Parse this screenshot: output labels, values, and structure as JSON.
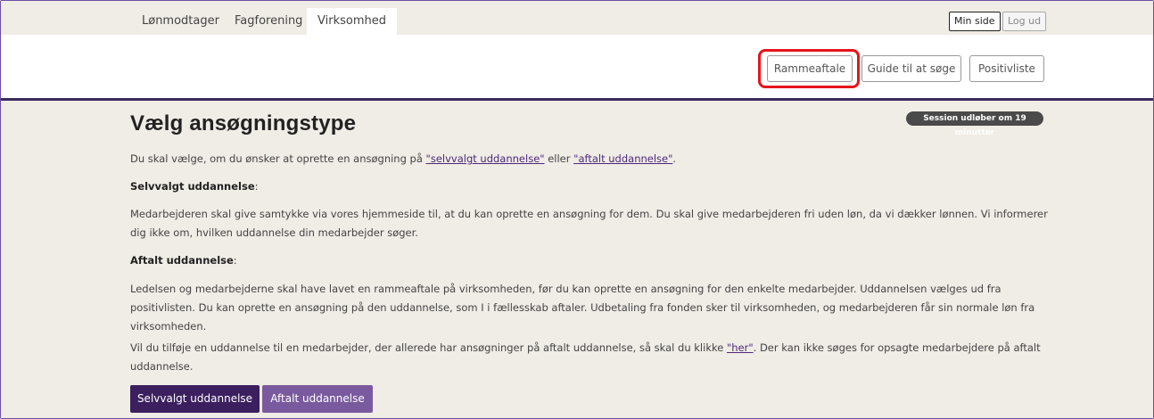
{
  "nav": {
    "tabs": [
      {
        "label": "Lønmodtager"
      },
      {
        "label": "Fagforening"
      },
      {
        "label": "Virksomhed"
      }
    ],
    "my_page": "Min side",
    "logout": "Log ud"
  },
  "subnav": {
    "buttons": [
      {
        "label": "Rammeaftale"
      },
      {
        "label": "Guide til at søge"
      },
      {
        "label": "Positivliste"
      }
    ],
    "highlight_color": "#e5141b"
  },
  "page": {
    "title": "Vælg ansøgningstype",
    "session_badge": "Session udløber om 19 minutter",
    "intro_prefix": "Du skal vælge, om du ønsker at oprette en ansøgning på ",
    "intro_link1": "\"selvvalgt uddannelse\"",
    "intro_middle": " eller ",
    "intro_link2": "\"aftalt uddannelse\"",
    "intro_suffix": ".",
    "selvvalgt_heading": "Selvvalgt uddannelse",
    "selvvalgt_colon": ":",
    "selvvalgt_text": "Medarbejderen skal give samtykke via vores hjemmeside til, at du kan oprette en ansøgning for dem. Du skal give medarbejderen fri uden løn, da vi dækker lønnen. Vi informerer dig ikke om, hvilken uddannelse din medarbejder søger.",
    "aftalt_heading": "Aftalt uddannelse",
    "aftalt_colon": ":",
    "aftalt_text": "Ledelsen og medarbejderne skal have lavet en rammeaftale på virksomheden, før du kan oprette en ansøgning for den enkelte medarbejder. Uddannelsen vælges ud fra positivlisten. Du kan oprette en ansøgning på den uddannelse, som I i fællesskab aftaler. Udbetaling fra fonden sker til virksomheden, og medarbejderen får sin normale løn fra virksomheden.",
    "add_prefix": "Vil du tilføje en uddannelse til en medarbejder, der allerede har ansøgninger på aftalt uddannelse, så skal du klikke ",
    "add_link": "\"her\"",
    "add_suffix": ". Der kan ikke søges for opsagte medarbejdere på aftalt uddannelse."
  },
  "actions": {
    "selvvalgt_button": "Selvvalgt uddannelse",
    "aftalt_button": "Aftalt uddannelse"
  },
  "colors": {
    "accent_dark": "#3b1f5e",
    "accent_light": "#7a5a9e",
    "background": "#f0ece6"
  }
}
